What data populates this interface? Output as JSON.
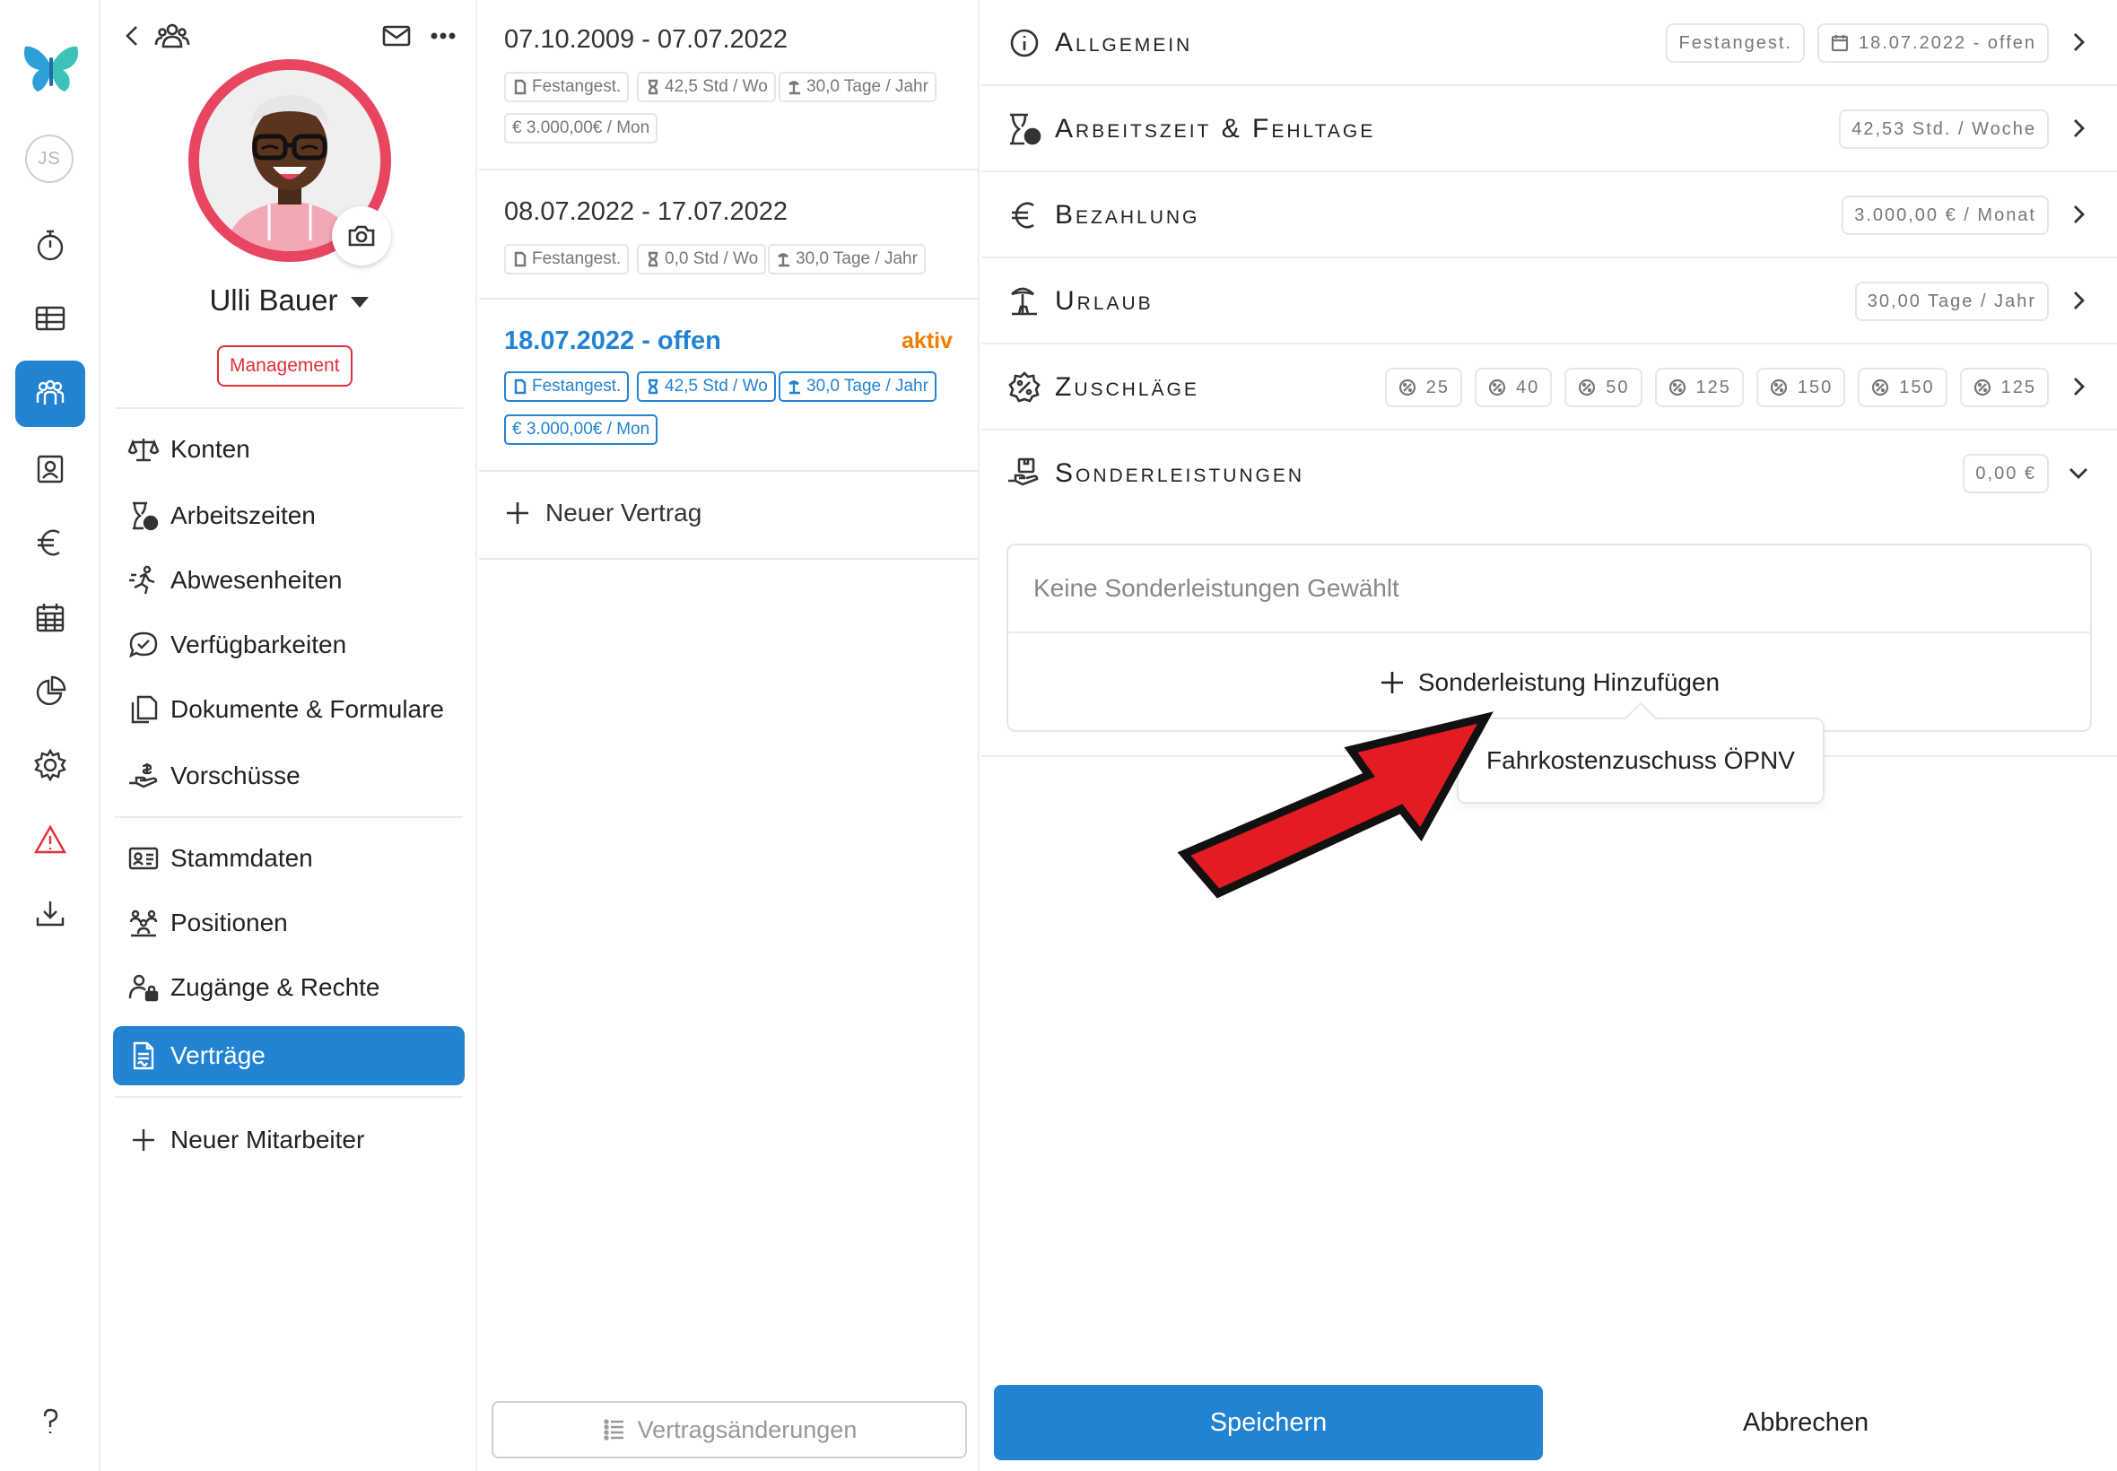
{
  "rail": {
    "logo": "butterfly-logo",
    "user_initials": "JS",
    "items": [
      {
        "icon": "stopwatch-icon"
      },
      {
        "icon": "table-icon"
      },
      {
        "icon": "team-icon",
        "active": true
      },
      {
        "icon": "profile-card-icon"
      },
      {
        "icon": "euro-icon"
      },
      {
        "icon": "calendar-icon"
      },
      {
        "icon": "pie-chart-icon"
      },
      {
        "icon": "gear-icon"
      },
      {
        "icon": "warning-icon"
      },
      {
        "icon": "download-icon"
      }
    ],
    "help_icon": "help-icon"
  },
  "profile": {
    "name": "Ulli Bauer",
    "role": "Management",
    "nav": [
      {
        "label": "Konten",
        "icon": "scale-icon"
      },
      {
        "label": "Arbeitszeiten",
        "icon": "hourglass-clock-icon"
      },
      {
        "label": "Abwesenheiten",
        "icon": "running-icon"
      },
      {
        "label": "Verfügbarkeiten",
        "icon": "chat-check-icon"
      },
      {
        "label": "Dokumente & Formulare",
        "icon": "documents-icon"
      },
      {
        "label": "Vorschüsse",
        "icon": "hand-money-icon"
      },
      {
        "label": "Stammdaten",
        "icon": "id-card-icon"
      },
      {
        "label": "Positionen",
        "icon": "positions-icon"
      },
      {
        "label": "Zugänge & Rechte",
        "icon": "user-lock-icon"
      },
      {
        "label": "Verträge",
        "icon": "contract-icon",
        "active": true
      }
    ],
    "new_employee": "Neuer Mitarbeiter"
  },
  "contracts": {
    "items": [
      {
        "dates": "07.10.2009 - 07.07.2022",
        "type": "Festangest.",
        "hours": "42,5 Std / Wo",
        "vacation": "30,0 Tage / Jahr",
        "salary": "€ 3.000,00€ / Mon"
      },
      {
        "dates": "08.07.2022 - 17.07.2022",
        "type": "Festangest.",
        "hours": "0,0 Std / Wo",
        "vacation": "30,0 Tage / Jahr"
      },
      {
        "dates": "18.07.2022 - offen",
        "status": "aktiv",
        "type": "Festangest.",
        "hours": "42,5 Std / Wo",
        "vacation": "30,0 Tage / Jahr",
        "salary": "€ 3.000,00€ / Mon"
      }
    ],
    "new_contract": "Neuer Vertrag",
    "changes_button": "Vertragsänderungen"
  },
  "details": {
    "sections": [
      {
        "title": "Allgemein",
        "icon": "info-icon",
        "chips": [
          "Festangest.",
          "18.07.2022 - offen"
        ]
      },
      {
        "title": "Arbeitszeit & Fehltage",
        "icon": "hourglass-clock-icon",
        "chips": [
          "42,53 Std. / Woche"
        ]
      },
      {
        "title": "Bezahlung",
        "icon": "euro-icon",
        "chips": [
          "3.000,00 € / Monat"
        ]
      },
      {
        "title": "Urlaub",
        "icon": "beach-icon",
        "chips": [
          "30,00 Tage / Jahr"
        ]
      },
      {
        "title": "Zuschläge",
        "icon": "percent-badge-icon",
        "chips": [
          "25",
          "40",
          "50",
          "125",
          "150",
          "150",
          "125"
        ]
      },
      {
        "title": "Sonderleistungen",
        "icon": "hand-box-icon",
        "chips": [
          "0,00 €"
        ]
      }
    ],
    "special_empty": "Keine Sonderleistungen Gewählt",
    "special_add": "Sonderleistung Hinzufügen",
    "tooltip": "Fahrkostenzuschuss ÖPNV",
    "save": "Speichern",
    "cancel": "Abbrechen"
  },
  "colors": {
    "accent": "#2283d3",
    "alert": "#e0303a",
    "active_status": "#f07d00",
    "arrow": "#e31b23"
  }
}
